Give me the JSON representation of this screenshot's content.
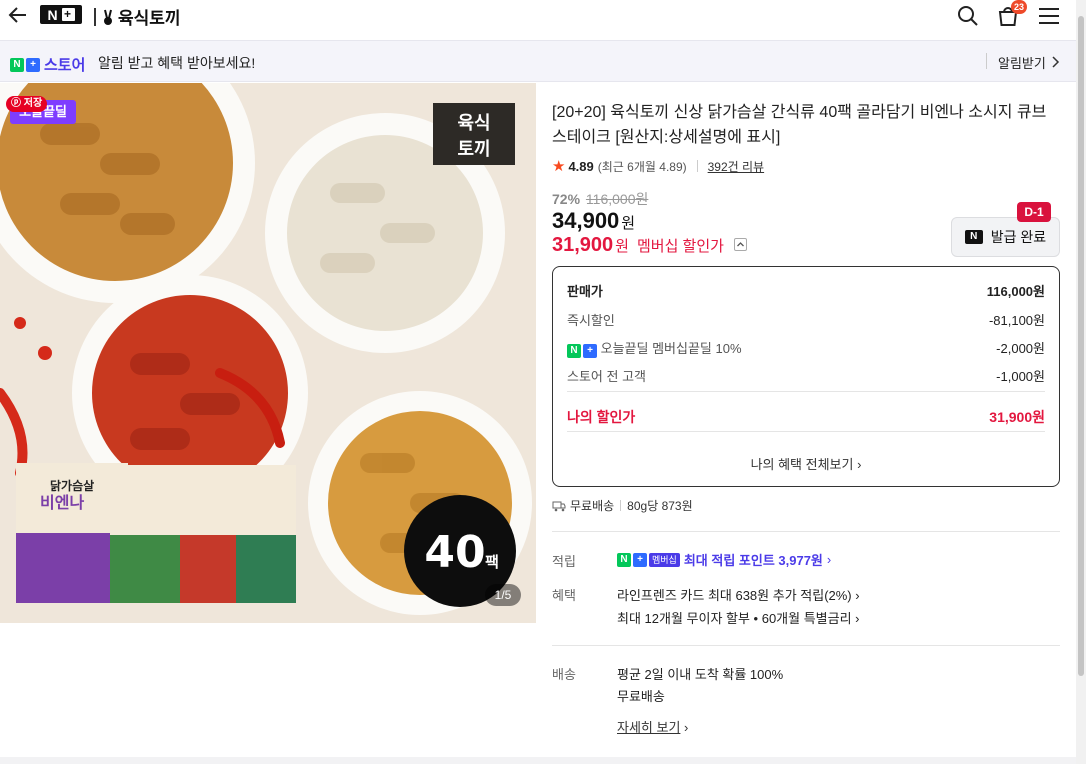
{
  "header": {
    "brand": "육식토끼",
    "nplus": "N+",
    "cart_count": "23"
  },
  "notice": {
    "store_label": "스토어",
    "message": "알림 받고 혜택 받아보세요!",
    "action": "알림받기"
  },
  "image": {
    "save_label": "저장",
    "deal_tag": "오늘끝딜",
    "pager": "1/5"
  },
  "product": {
    "title": "[20+20] 육식토끼 신상 닭가슴살 간식류 40팩 골라담기 비엔나 소시지 큐브 스테이크 [원산지:상세설명에 표시]",
    "rating": "4.89",
    "rating_sub": "(최근 6개월 4.89",
    "rating_sub_end": ")",
    "reviews": "392건 리뷰",
    "discount_pct": "72%",
    "original_price": "116,000원",
    "price": "34,900",
    "price_unit": "원",
    "member_price": "31,900",
    "member_unit": "원",
    "member_label": "멤버십 할인가",
    "coupon_label": "발급 완료",
    "dday": "D-1"
  },
  "breakdown": {
    "rows": [
      {
        "label": "판매가",
        "value": "116,000원"
      },
      {
        "label": "즉시할인",
        "value": "-81,100원"
      },
      {
        "label": "오늘끝딜 멤버십끝딜 10%",
        "value": "-2,000원"
      },
      {
        "label": "스토어 전 고객",
        "value": "-1,000원"
      }
    ],
    "mine_label": "나의 할인가",
    "mine_value": "31,900원",
    "all_benefits": "나의 혜택 전체보기"
  },
  "shipping": {
    "free": "무료배송",
    "unit": "80g당 873원"
  },
  "points": {
    "label": "적립",
    "badge": "멤버십",
    "text": "최대 적립 포인트 3,977원"
  },
  "benefits": {
    "label": "혜택",
    "line1": "라인프렌즈 카드 최대 638원 추가 적립(2%)",
    "line2": "최대 12개월 무이자 할부 • 60개월 특별금리"
  },
  "delivery": {
    "label": "배송",
    "line1": "평균 2일 이내 도착 확률 100%",
    "line2": "무료배송",
    "detail": "자세히 보기"
  },
  "colors": {
    "accent_purple": "#4b3be8",
    "price_red": "#e3173f",
    "naver_green": "#03c75a"
  }
}
